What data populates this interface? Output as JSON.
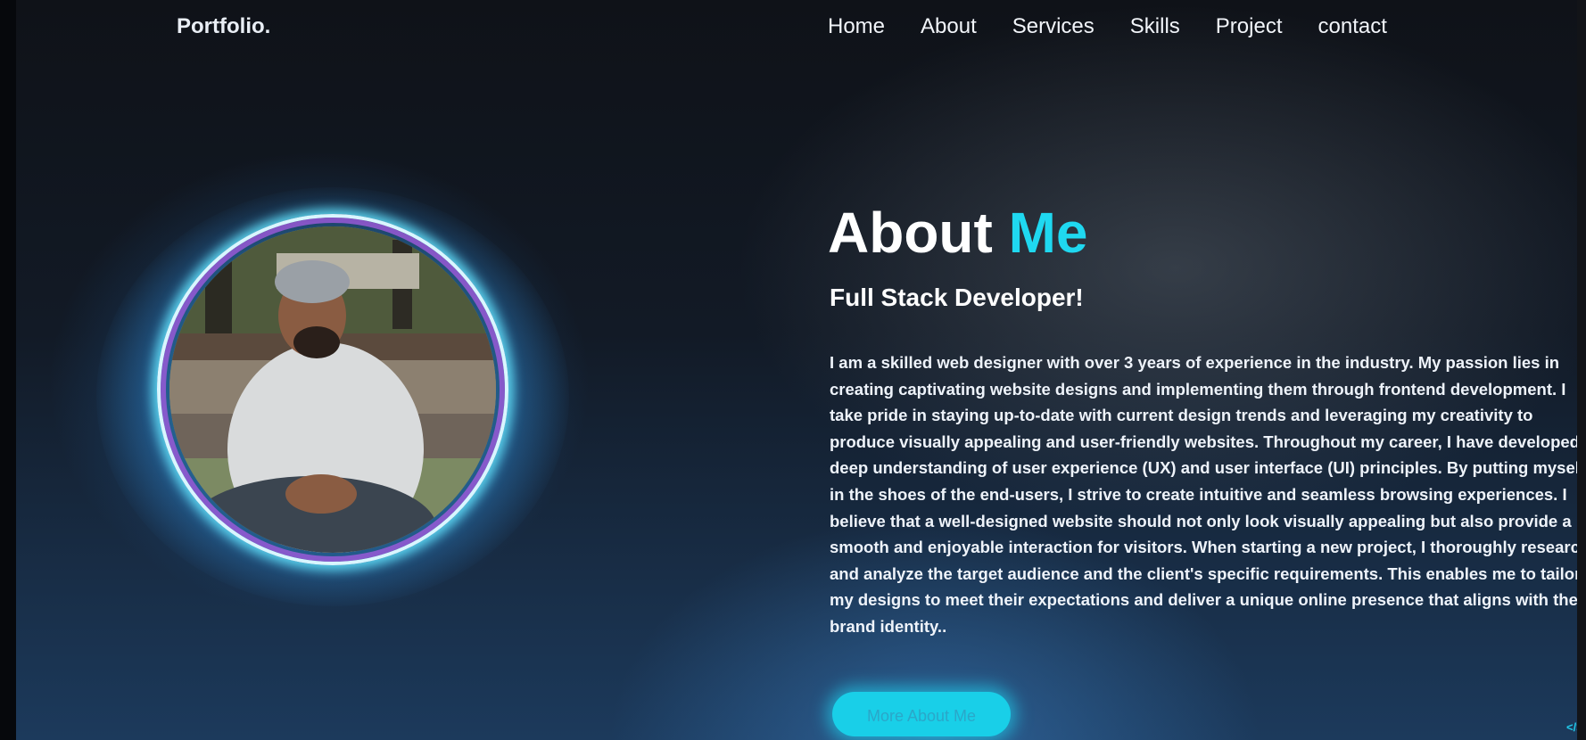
{
  "header": {
    "logo": "Portfolio.",
    "nav": [
      "Home",
      "About",
      "Services",
      "Skills",
      "Project",
      "contact"
    ]
  },
  "about": {
    "title_main": "About",
    "title_accent": "Me",
    "subtitle": "Full Stack Developer!",
    "bio": "I am a skilled web designer with over 3 years of experience in the industry. My passion lies in creating captivating website designs and implementing them through frontend development. I take pride in staying up-to-date with current design trends and leveraging my creativity to produce visually appealing and user-friendly websites. Throughout my career, I have developed a deep understanding of user experience (UX) and user interface (UI) principles. By putting myself in the shoes of the end-users, I strive to create intuitive and seamless browsing experiences. I believe that a well-designed website should not only look visually appealing but also provide a smooth and enjoyable interaction for visitors. When starting a new project, I thoroughly research and analyze the target audience and the client's specific requirements. This enables me to tailor my designs to meet their expectations and deliver a unique online presence that aligns with their brand identity..",
    "button_label": "More About Me"
  },
  "icons": {
    "corner_icon": "</>"
  },
  "colors": {
    "accent": "#1fd8f0",
    "text": "#ffffff"
  }
}
